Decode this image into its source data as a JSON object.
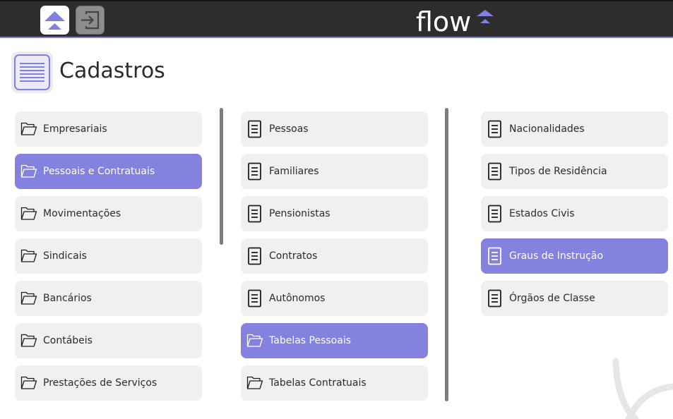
{
  "topbar": {
    "home_icon": "home-chevron-icon",
    "exit_icon": "sign-in-icon",
    "brand": "flow",
    "colors": {
      "bar": "#2e2c2c",
      "accent": "#7f80e2"
    }
  },
  "page": {
    "title": "Cadastros",
    "icon": "document-list-icon"
  },
  "colors": {
    "active": "#8482de",
    "item_bg": "#f0f0f0"
  },
  "columns": [
    {
      "items": [
        {
          "label": "Empresariais",
          "icon": "folder-icon",
          "active": false
        },
        {
          "label": "Pessoais e Contratuais",
          "icon": "folder-icon",
          "active": true
        },
        {
          "label": "Movimentações",
          "icon": "folder-icon",
          "active": false
        },
        {
          "label": "Sindicais",
          "icon": "folder-icon",
          "active": false
        },
        {
          "label": "Bancários",
          "icon": "folder-icon",
          "active": false
        },
        {
          "label": "Contábeis",
          "icon": "folder-icon",
          "active": false
        },
        {
          "label": "Prestações de Serviços",
          "icon": "folder-icon",
          "active": false
        }
      ]
    },
    {
      "items": [
        {
          "label": "Pessoas",
          "icon": "document-icon",
          "active": false
        },
        {
          "label": "Familiares",
          "icon": "document-icon",
          "active": false
        },
        {
          "label": "Pensionistas",
          "icon": "document-icon",
          "active": false
        },
        {
          "label": "Contratos",
          "icon": "document-icon",
          "active": false
        },
        {
          "label": "Autônomos",
          "icon": "document-icon",
          "active": false
        },
        {
          "label": "Tabelas Pessoais",
          "icon": "folder-icon",
          "active": true
        },
        {
          "label": "Tabelas Contratuais",
          "icon": "folder-icon",
          "active": false
        }
      ]
    },
    {
      "items": [
        {
          "label": "Nacionalidades",
          "icon": "document-icon",
          "active": false
        },
        {
          "label": "Tipos de Residência",
          "icon": "document-icon",
          "active": false
        },
        {
          "label": "Estados Civis",
          "icon": "document-icon",
          "active": false
        },
        {
          "label": "Graus de Instrução",
          "icon": "document-icon",
          "active": true
        },
        {
          "label": "Órgãos de Classe",
          "icon": "document-icon",
          "active": false
        }
      ]
    }
  ]
}
